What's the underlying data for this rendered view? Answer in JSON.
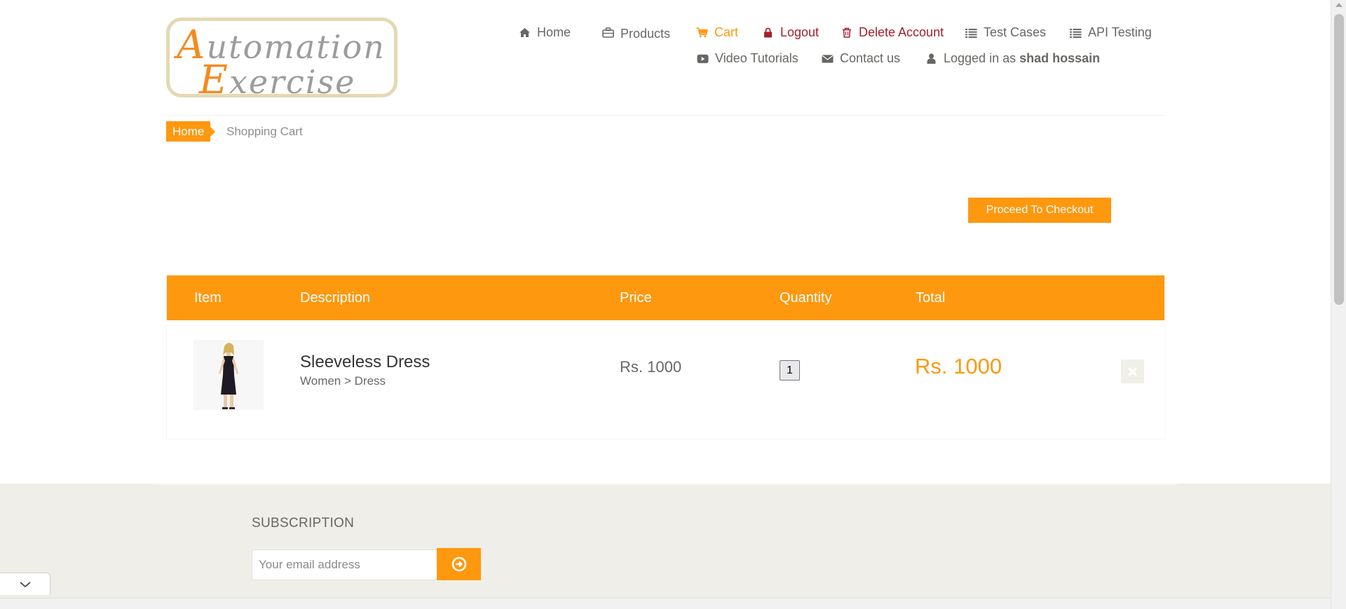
{
  "logo": {
    "line1_cap": "A",
    "line1_rest": "utomation",
    "line2_cap": "E",
    "line2_rest": "xercise"
  },
  "nav": {
    "home": "Home",
    "products": "Products",
    "cart": "Cart",
    "logout": "Logout",
    "delete_account": "Delete Account",
    "test_cases": "Test Cases",
    "api_testing": "API Testing",
    "video_tutorials": "Video Tutorials",
    "contact_us": "Contact us",
    "logged_in_prefix": "Logged in as",
    "username": "shad hossain"
  },
  "breadcrumb": {
    "home": "Home",
    "current": "Shopping Cart"
  },
  "checkout_button": "Proceed To Checkout",
  "table": {
    "headers": [
      "Item",
      "Description",
      "Price",
      "Quantity",
      "Total"
    ],
    "rows": [
      {
        "name": "Sleeveless Dress",
        "category": "Women > Dress",
        "price": "Rs. 1000",
        "quantity": "1",
        "total": "Rs. 1000"
      }
    ]
  },
  "footer": {
    "subscription_title": "SUBSCRIPTION",
    "email_placeholder": "Your email address"
  },
  "colors": {
    "accent": "#fe980f",
    "danger": "#a5202a",
    "text": "#696763",
    "footer_bg": "#efeee8"
  },
  "icons": [
    "home-icon",
    "briefcase-icon",
    "cart-icon",
    "lock-icon",
    "trash-icon",
    "list-icon",
    "youtube-play-icon",
    "envelope-icon",
    "user-icon",
    "close-icon",
    "arrow-circle-right-icon",
    "chevron-down-icon"
  ]
}
